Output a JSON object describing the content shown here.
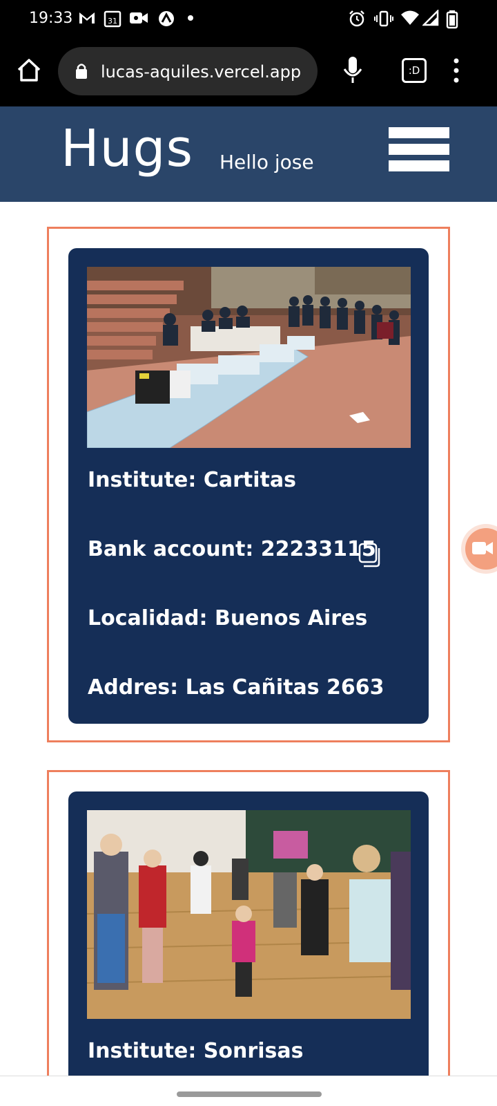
{
  "status_bar": {
    "time": "19:33",
    "left_icons": [
      "gmail-icon",
      "calendar-icon",
      "video-call-icon",
      "vpn-icon",
      "dot-icon"
    ],
    "calendar_day": "31",
    "right_icons": [
      "alarm-icon",
      "vibrate-icon",
      "wifi-icon",
      "signal-icon",
      "battery-icon"
    ]
  },
  "browser": {
    "url": "lucas-aquiles.vercel.app",
    "tab_switcher_label": ":D"
  },
  "header": {
    "logo": "Hugs",
    "greeting": "Hello jose"
  },
  "cards": [
    {
      "institute": "Institute: Cartitas",
      "bank_account": "Bank account: 22233115",
      "locality": "Localidad: Buenos Aires",
      "address": "Addres: Las Cañitas 2663",
      "image_alt": "donation event photo"
    },
    {
      "institute": "Institute: Sonrisas",
      "image_alt": "children dancing photo"
    }
  ],
  "colors": {
    "header_bg": "#2a4569",
    "card_bg": "#152e57",
    "frame_border": "#ee7f5d"
  }
}
